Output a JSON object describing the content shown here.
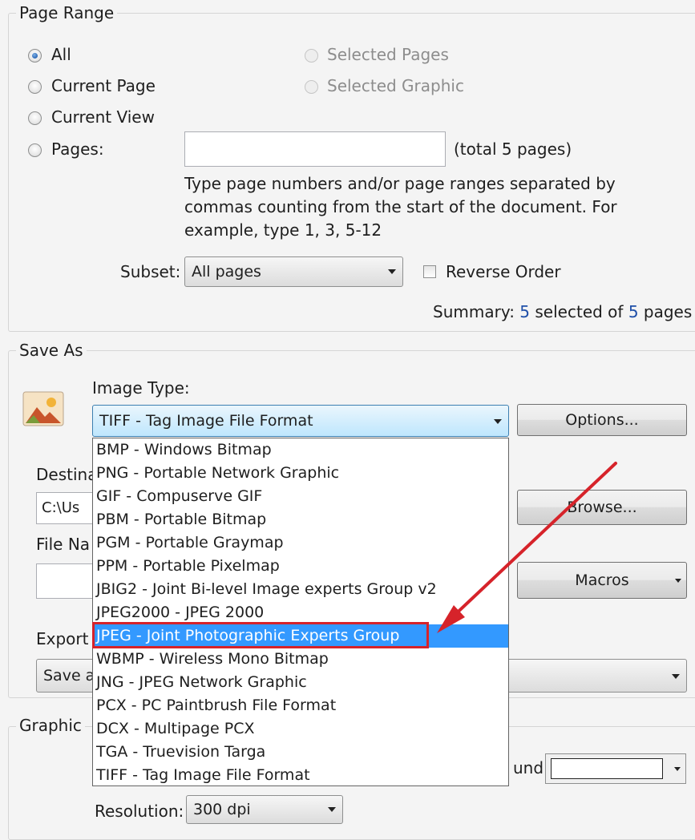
{
  "page_range": {
    "title": "Page Range",
    "radio_all": "All",
    "radio_current_page": "Current Page",
    "radio_current_view": "Current View",
    "radio_pages": "Pages:",
    "radio_selected_pages": "Selected Pages",
    "radio_selected_graphic": "Selected Graphic",
    "pages_value": "",
    "total_pages": "(total 5 pages)",
    "help_line1": "Type page numbers and/or page ranges separated by",
    "help_line2": "commas counting from the start of the document. For",
    "help_line3": "example, type 1, 3, 5-12",
    "subset_label": "Subset:",
    "subset_value": "All pages",
    "reverse_order": "Reverse Order",
    "summary_prefix": "Summary: ",
    "summary_selected": "5",
    "summary_middle": " selected of ",
    "summary_total": "5",
    "summary_suffix": " pages"
  },
  "save_as": {
    "title": "Save As",
    "image_type_label": "Image Type:",
    "image_type_value": "TIFF - Tag Image File Format",
    "options_button": "Options...",
    "destination_label": "Destina",
    "destination_value": "C:\\Us",
    "browse_button": "Browse...",
    "file_name_label": "File Na",
    "macros_button": "Macros",
    "export_label": "Export",
    "export_value": "Save a"
  },
  "dropdown": {
    "options": [
      "BMP - Windows Bitmap",
      "PNG - Portable Network Graphic",
      "GIF - Compuserve GIF",
      "PBM - Portable Bitmap",
      "PGM - Portable Graymap",
      "PPM - Portable Pixelmap",
      "JBIG2 - Joint Bi-level Image experts Group v2",
      "JPEG2000 - JPEG 2000",
      "JPEG - Joint Photographic Experts Group",
      "WBMP - Wireless Mono Bitmap",
      "JNG - JPEG Network Graphic",
      "PCX - PC Paintbrush File Format",
      "DCX - Multipage PCX",
      "TGA - Truevision Targa",
      "TIFF - Tag Image File Format"
    ],
    "selected": "JPEG - Joint Photographic Experts Group"
  },
  "graphic": {
    "title": "Graphic",
    "background_label": "und:",
    "resolution_label": "Resolution:",
    "resolution_value": "300 dpi"
  },
  "colors": {
    "selection": "#3399ff",
    "annotation": "#d6232a",
    "summary_number": "#1f4fa8"
  },
  "icons": {
    "image_type_icon": "image-icon",
    "annotation_arrow": "red-arrow"
  }
}
